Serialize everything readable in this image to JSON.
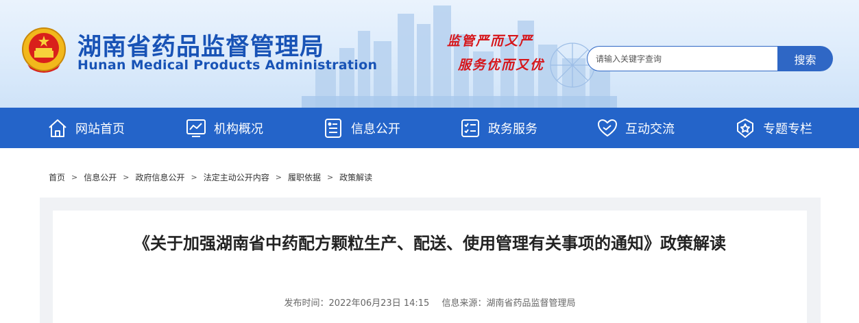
{
  "header": {
    "title_cn": "湖南省药品监督管理局",
    "title_en": "Hunan Medical Products Administration",
    "slogan_line1": "监管严而又严",
    "slogan_line2": "服务优而又优"
  },
  "search": {
    "placeholder": "请输入关键字查询",
    "button_label": "搜索"
  },
  "nav": {
    "items": [
      {
        "label": "网站首页",
        "icon": "home-icon"
      },
      {
        "label": "机构概况",
        "icon": "chart-monitor-icon"
      },
      {
        "label": "信息公开",
        "icon": "info-document-icon"
      },
      {
        "label": "政务服务",
        "icon": "checklist-icon"
      },
      {
        "label": "互动交流",
        "icon": "heart-hands-icon"
      },
      {
        "label": "专题专栏",
        "icon": "star-badge-icon"
      }
    ]
  },
  "breadcrumb": {
    "items": [
      "首页",
      "信息公开",
      "政府信息公开",
      "法定主动公开内容",
      "履职依据",
      "政策解读"
    ],
    "separator": ">"
  },
  "article": {
    "title": "《关于加强湖南省中药配方颗粒生产、配送、使用管理有关事项的通知》政策解读",
    "publish_time": "发布时间：2022年06月23日 14:15",
    "source": "信息来源：湖南省药品监督管理局"
  },
  "colors": {
    "brand_blue": "#2464c9",
    "title_blue": "#1853b6",
    "slogan_red": "#d6161b"
  }
}
